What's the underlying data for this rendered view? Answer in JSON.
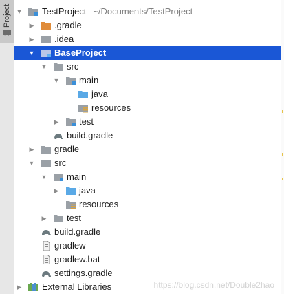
{
  "panel": {
    "tab_label": "1: Project"
  },
  "tree": {
    "root": {
      "name": "TestProject",
      "path": "~/Documents/TestProject"
    },
    "gradle_hidden": ".gradle",
    "idea": ".idea",
    "baseproject": "BaseProject",
    "bp_src": "src",
    "bp_main": "main",
    "bp_java": "java",
    "bp_resources": "resources",
    "bp_test": "test",
    "bp_build": "build.gradle",
    "gradle": "gradle",
    "src": "src",
    "main": "main",
    "java": "java",
    "resources": "resources",
    "test": "test",
    "build": "build.gradle",
    "gradlew": "gradlew",
    "gradlew_bat": "gradlew.bat",
    "settings": "settings.gradle",
    "external": "External Libraries"
  },
  "watermark": "https://blog.csdn.net/Double2hao",
  "colors": {
    "selection": "#1a57d6",
    "folder": "#9aa0a6",
    "folder_orange": "#e08c3a",
    "source_folder": "#5aa9e6",
    "module_marker": "#3a8fd8"
  }
}
